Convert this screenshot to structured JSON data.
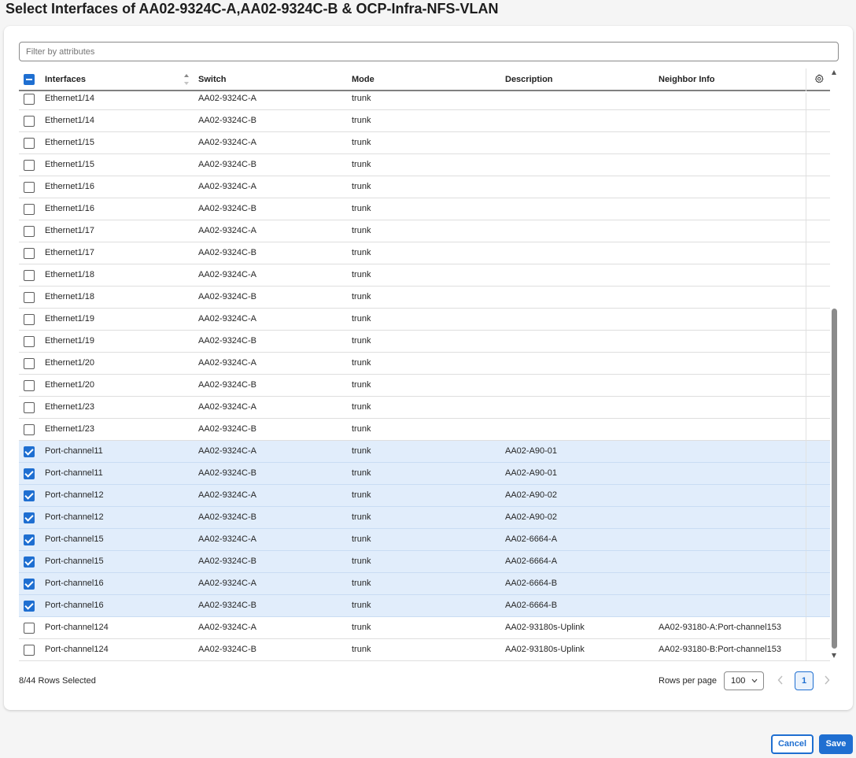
{
  "title": "Select Interfaces of AA02-9324C-A,AA02-9324C-B & OCP-Infra-NFS-VLAN",
  "filter": {
    "placeholder": "Filter by attributes"
  },
  "columns": {
    "interfaces": "Interfaces",
    "switch": "Switch",
    "mode": "Mode",
    "description": "Description",
    "neighbor": "Neighbor Info"
  },
  "select_all_state": "indeterminate",
  "rows": [
    {
      "iface": "Ethernet1/14",
      "switch": "AA02-9324C-A",
      "mode": "trunk",
      "desc": "",
      "neighbor": "",
      "checked": false
    },
    {
      "iface": "Ethernet1/14",
      "switch": "AA02-9324C-B",
      "mode": "trunk",
      "desc": "",
      "neighbor": "",
      "checked": false
    },
    {
      "iface": "Ethernet1/15",
      "switch": "AA02-9324C-A",
      "mode": "trunk",
      "desc": "",
      "neighbor": "",
      "checked": false
    },
    {
      "iface": "Ethernet1/15",
      "switch": "AA02-9324C-B",
      "mode": "trunk",
      "desc": "",
      "neighbor": "",
      "checked": false
    },
    {
      "iface": "Ethernet1/16",
      "switch": "AA02-9324C-A",
      "mode": "trunk",
      "desc": "",
      "neighbor": "",
      "checked": false
    },
    {
      "iface": "Ethernet1/16",
      "switch": "AA02-9324C-B",
      "mode": "trunk",
      "desc": "",
      "neighbor": "",
      "checked": false
    },
    {
      "iface": "Ethernet1/17",
      "switch": "AA02-9324C-A",
      "mode": "trunk",
      "desc": "",
      "neighbor": "",
      "checked": false
    },
    {
      "iface": "Ethernet1/17",
      "switch": "AA02-9324C-B",
      "mode": "trunk",
      "desc": "",
      "neighbor": "",
      "checked": false
    },
    {
      "iface": "Ethernet1/18",
      "switch": "AA02-9324C-A",
      "mode": "trunk",
      "desc": "",
      "neighbor": "",
      "checked": false
    },
    {
      "iface": "Ethernet1/18",
      "switch": "AA02-9324C-B",
      "mode": "trunk",
      "desc": "",
      "neighbor": "",
      "checked": false
    },
    {
      "iface": "Ethernet1/19",
      "switch": "AA02-9324C-A",
      "mode": "trunk",
      "desc": "",
      "neighbor": "",
      "checked": false
    },
    {
      "iface": "Ethernet1/19",
      "switch": "AA02-9324C-B",
      "mode": "trunk",
      "desc": "",
      "neighbor": "",
      "checked": false
    },
    {
      "iface": "Ethernet1/20",
      "switch": "AA02-9324C-A",
      "mode": "trunk",
      "desc": "",
      "neighbor": "",
      "checked": false
    },
    {
      "iface": "Ethernet1/20",
      "switch": "AA02-9324C-B",
      "mode": "trunk",
      "desc": "",
      "neighbor": "",
      "checked": false
    },
    {
      "iface": "Ethernet1/23",
      "switch": "AA02-9324C-A",
      "mode": "trunk",
      "desc": "",
      "neighbor": "",
      "checked": false
    },
    {
      "iface": "Ethernet1/23",
      "switch": "AA02-9324C-B",
      "mode": "trunk",
      "desc": "",
      "neighbor": "",
      "checked": false
    },
    {
      "iface": "Port-channel11",
      "switch": "AA02-9324C-A",
      "mode": "trunk",
      "desc": "AA02-A90-01",
      "neighbor": "",
      "checked": true
    },
    {
      "iface": "Port-channel11",
      "switch": "AA02-9324C-B",
      "mode": "trunk",
      "desc": "AA02-A90-01",
      "neighbor": "",
      "checked": true
    },
    {
      "iface": "Port-channel12",
      "switch": "AA02-9324C-A",
      "mode": "trunk",
      "desc": "AA02-A90-02",
      "neighbor": "",
      "checked": true
    },
    {
      "iface": "Port-channel12",
      "switch": "AA02-9324C-B",
      "mode": "trunk",
      "desc": "AA02-A90-02",
      "neighbor": "",
      "checked": true
    },
    {
      "iface": "Port-channel15",
      "switch": "AA02-9324C-A",
      "mode": "trunk",
      "desc": "AA02-6664-A",
      "neighbor": "",
      "checked": true
    },
    {
      "iface": "Port-channel15",
      "switch": "AA02-9324C-B",
      "mode": "trunk",
      "desc": "AA02-6664-A",
      "neighbor": "",
      "checked": true
    },
    {
      "iface": "Port-channel16",
      "switch": "AA02-9324C-A",
      "mode": "trunk",
      "desc": "AA02-6664-B",
      "neighbor": "",
      "checked": true
    },
    {
      "iface": "Port-channel16",
      "switch": "AA02-9324C-B",
      "mode": "trunk",
      "desc": "AA02-6664-B",
      "neighbor": "",
      "checked": true
    },
    {
      "iface": "Port-channel124",
      "switch": "AA02-9324C-A",
      "mode": "trunk",
      "desc": "AA02-93180s-Uplink",
      "neighbor": "AA02-93180-A:Port-channel153",
      "checked": false
    },
    {
      "iface": "Port-channel124",
      "switch": "AA02-9324C-B",
      "mode": "trunk",
      "desc": "AA02-93180s-Uplink",
      "neighbor": "AA02-93180-B:Port-channel153",
      "checked": false
    }
  ],
  "footer": {
    "selected_text": "8/44 Rows Selected",
    "rows_per_page_label": "Rows per page",
    "rows_per_page_value": "100",
    "current_page": "1"
  },
  "buttons": {
    "cancel": "Cancel",
    "save": "Save"
  },
  "colors": {
    "accent": "#1f6fd1",
    "selected_row": "#e1edfb"
  },
  "icons": [
    "sort-icon",
    "gear-icon",
    "chevron-down-icon",
    "chevron-left-icon",
    "chevron-right-icon"
  ]
}
